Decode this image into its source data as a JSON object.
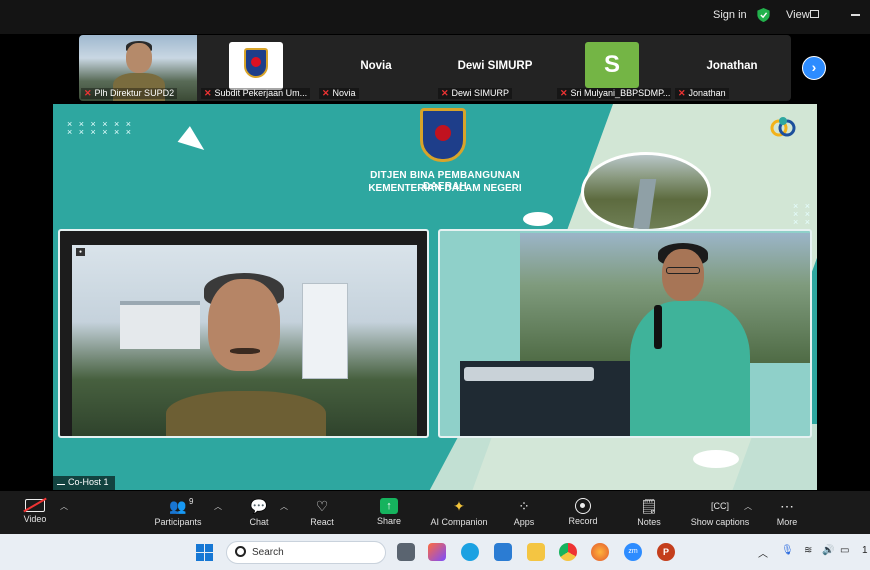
{
  "topbar": {
    "signin_label": "Sign in",
    "view_label": "View"
  },
  "participants_strip": {
    "tiles": [
      {
        "name": "",
        "label": "Plh Direktur SUPD2"
      },
      {
        "name": "",
        "label": "Subdit Pekerjaan Um..."
      },
      {
        "name": "Novia",
        "label": "Novia"
      },
      {
        "name": "Dewi SIMURP",
        "label": "Dewi SIMURP"
      },
      {
        "name": "S",
        "label": "Sri Mulyani_BBPSDMP..."
      },
      {
        "name": "Jonathan",
        "label": "Jonathan"
      }
    ]
  },
  "slide": {
    "title_line1": "DITJEN BINA PEMBANGUNAN DAERAH",
    "title_line2": "KEMENTERIAN DALAM NEGERI",
    "left_tag": "Co-Host 1"
  },
  "toolbar": {
    "items": [
      {
        "label": "Video",
        "icon": "video-off-icon"
      },
      {
        "label": "Participants",
        "icon": "participants-icon",
        "count": "9"
      },
      {
        "label": "Chat",
        "icon": "chat-icon"
      },
      {
        "label": "React",
        "icon": "heart-icon"
      },
      {
        "label": "Share",
        "icon": "share-icon"
      },
      {
        "label": "AI Companion",
        "icon": "sparkle-icon"
      },
      {
        "label": "Apps",
        "icon": "apps-icon"
      },
      {
        "label": "Record",
        "icon": "record-icon"
      },
      {
        "label": "Notes",
        "icon": "notes-icon"
      },
      {
        "label": "Show captions",
        "icon": "captions-icon"
      },
      {
        "label": "More",
        "icon": "more-icon"
      }
    ]
  },
  "taskbar": {
    "search_placeholder": "Search",
    "clock_fragment": "1"
  },
  "colors": {
    "slide_teal": "#2ea7a0",
    "accent_blue": "#2d8cff",
    "share_green": "#16b35e",
    "mic_red": "#e33333"
  }
}
